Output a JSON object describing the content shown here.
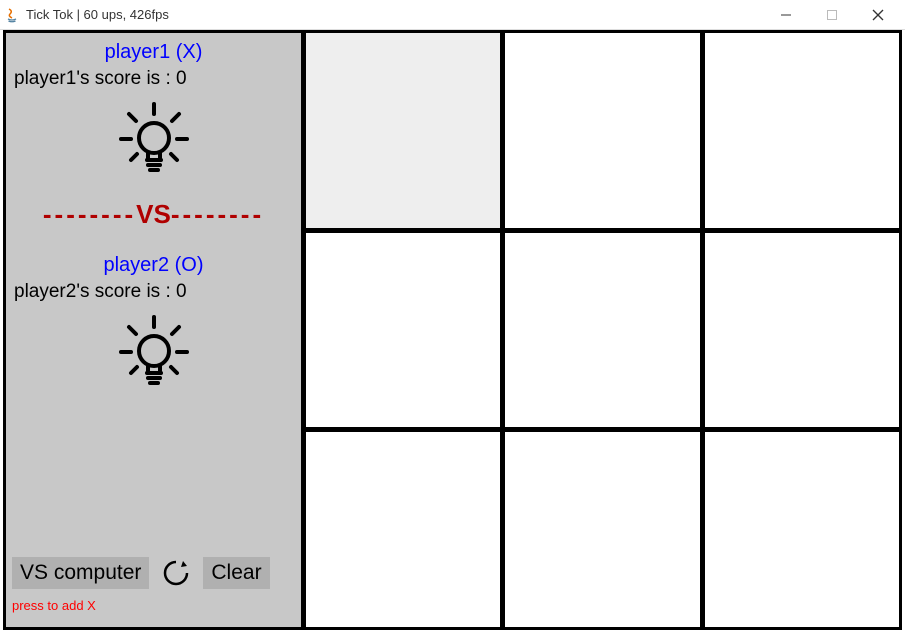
{
  "window": {
    "title": "Tick Tok  |  60 ups, 426fps"
  },
  "player1": {
    "title": "player1 (X)",
    "score_text": "player1's score is : 0"
  },
  "vs_label": "VS",
  "player2": {
    "title": "player2 (O)",
    "score_text": "player2's score is : 0"
  },
  "buttons": {
    "vs_computer": "VS computer",
    "clear": "Clear"
  },
  "hint": "press to add X",
  "board": {
    "cells": [
      "",
      "",
      "",
      "",
      "",
      "",
      "",
      "",
      ""
    ],
    "hovered_index": 0
  }
}
